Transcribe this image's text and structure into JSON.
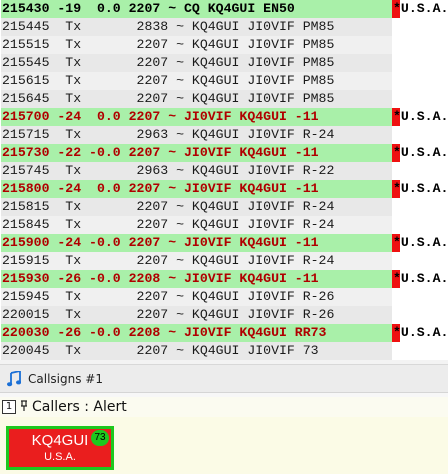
{
  "log_rows": [
    {
      "text": "215430 -19  0.0 2207 ~ CQ KQ4GUI EN50",
      "style": "cq",
      "country": "*U.S.A."
    },
    {
      "text": "215445  Tx       2838 ~ KQ4GUI JI0VIF PM85",
      "style": "tx",
      "country": ""
    },
    {
      "text": "215515  Tx       2207 ~ KQ4GUI JI0VIF PM85",
      "style": "tx",
      "country": ""
    },
    {
      "text": "215545  Tx       2207 ~ KQ4GUI JI0VIF PM85",
      "style": "tx",
      "country": ""
    },
    {
      "text": "215615  Tx       2207 ~ KQ4GUI JI0VIF PM85",
      "style": "tx",
      "country": ""
    },
    {
      "text": "215645  Tx       2207 ~ KQ4GUI JI0VIF PM85",
      "style": "tx",
      "country": ""
    },
    {
      "text": "215700 -24  0.0 2207 ~ JI0VIF KQ4GUI -11",
      "style": "me",
      "country": "*U.S.A."
    },
    {
      "text": "215715  Tx       2963 ~ KQ4GUI JI0VIF R-24",
      "style": "tx",
      "country": ""
    },
    {
      "text": "215730 -22 -0.0 2207 ~ JI0VIF KQ4GUI -11",
      "style": "me",
      "country": "*U.S.A."
    },
    {
      "text": "215745  Tx       2963 ~ KQ4GUI JI0VIF R-22",
      "style": "tx",
      "country": ""
    },
    {
      "text": "215800 -24  0.0 2207 ~ JI0VIF KQ4GUI -11",
      "style": "me",
      "country": "*U.S.A."
    },
    {
      "text": "215815  Tx       2207 ~ KQ4GUI JI0VIF R-24",
      "style": "tx",
      "country": ""
    },
    {
      "text": "215845  Tx       2207 ~ KQ4GUI JI0VIF R-24",
      "style": "tx",
      "country": ""
    },
    {
      "text": "215900 -24 -0.0 2207 ~ JI0VIF KQ4GUI -11",
      "style": "me",
      "country": "*U.S.A."
    },
    {
      "text": "215915  Tx       2207 ~ KQ4GUI JI0VIF R-24",
      "style": "tx",
      "country": ""
    },
    {
      "text": "215930 -26 -0.0 2208 ~ JI0VIF KQ4GUI -11",
      "style": "me",
      "country": "*U.S.A."
    },
    {
      "text": "215945  Tx       2207 ~ KQ4GUI JI0VIF R-26",
      "style": "tx",
      "country": ""
    },
    {
      "text": "220015  Tx       2207 ~ KQ4GUI JI0VIF R-26",
      "style": "tx",
      "country": ""
    },
    {
      "text": "220030 -26 -0.0 2208 ~ JI0VIF KQ4GUI RR73",
      "style": "me",
      "country": "*U.S.A."
    },
    {
      "text": "220045  Tx       2207 ~ KQ4GUI JI0VIF 73",
      "style": "tx",
      "country": ""
    }
  ],
  "callsigns_window": {
    "title": "Callsigns #1",
    "icon": "music-note-icon"
  },
  "callers_panel": {
    "index": "1",
    "pin_icon": "pin-icon",
    "title": "Callers : Alert",
    "card": {
      "callsign": "KQ4GUI",
      "country": "U.S.A.",
      "count": "73"
    }
  },
  "colors": {
    "cq_highlight": "#a9f0a9",
    "my_call_text": "#b00000",
    "tx_background": "#e8e8e8",
    "alert_flag": "#ee1111",
    "card_background": "#ea1e1e",
    "card_border": "#1ec81e"
  }
}
